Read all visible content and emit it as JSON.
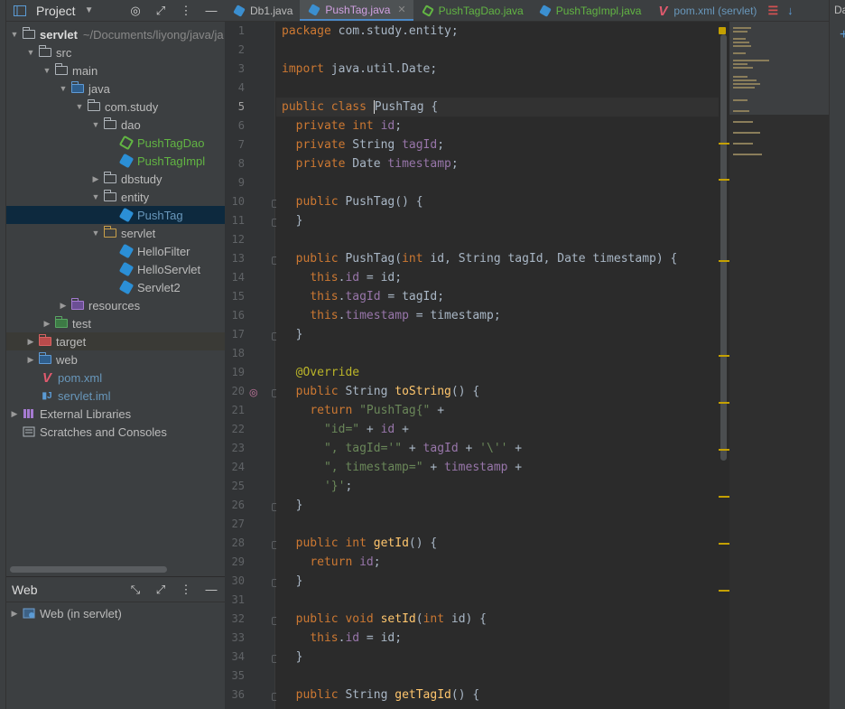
{
  "project_panel": {
    "title": "Project",
    "tree": [
      {
        "label": "servlet",
        "path": "~/Documents/liyong/java/ja"
      },
      {
        "label": "src"
      },
      {
        "label": "main"
      },
      {
        "label": "java"
      },
      {
        "label": "com.study"
      },
      {
        "label": "dao"
      },
      {
        "label": "PushTagDao"
      },
      {
        "label": "PushTagImpl"
      },
      {
        "label": "dbstudy"
      },
      {
        "label": "entity"
      },
      {
        "label": "PushTag"
      },
      {
        "label": "servlet"
      },
      {
        "label": "HelloFilter"
      },
      {
        "label": "HelloServlet"
      },
      {
        "label": "Servlet2"
      },
      {
        "label": "resources"
      },
      {
        "label": "test"
      },
      {
        "label": "target"
      },
      {
        "label": "web"
      },
      {
        "label": "pom.xml"
      },
      {
        "label": "servlet.iml"
      },
      {
        "label": "External Libraries"
      },
      {
        "label": "Scratches and Consoles"
      }
    ]
  },
  "web_panel": {
    "title": "Web",
    "items": [
      {
        "label": "Web (in servlet)"
      }
    ]
  },
  "tabs": [
    {
      "label": "Db1.java",
      "icon": "java-class-icon"
    },
    {
      "label": "PushTag.java",
      "icon": "java-class-icon",
      "active": true
    },
    {
      "label": "PushTagDao.java",
      "icon": "java-interface-icon"
    },
    {
      "label": "PushTagImpl.java",
      "icon": "java-class-icon"
    },
    {
      "label": "pom.xml (servlet)",
      "icon": "maven-icon"
    }
  ],
  "right_panel": {
    "label": "Da"
  },
  "editor": {
    "line_numbers": [
      "1",
      "2",
      "3",
      "4",
      "5",
      "6",
      "7",
      "8",
      "9",
      "10",
      "11",
      "12",
      "13",
      "14",
      "15",
      "16",
      "17",
      "18",
      "19",
      "20",
      "21",
      "22",
      "23",
      "24",
      "25",
      "26",
      "27",
      "28",
      "29",
      "30",
      "31",
      "32",
      "33",
      "34",
      "35",
      "36"
    ],
    "lines": [
      "package com.study.entity;",
      "",
      "import java.util.Date;",
      "",
      "public class PushTag {",
      "  private int id;",
      "  private String tagId;",
      "  private Date timestamp;",
      "",
      "  public PushTag() {",
      "  }",
      "",
      "  public PushTag(int id, String tagId, Date timestamp) {",
      "    this.id = id;",
      "    this.tagId = tagId;",
      "    this.timestamp = timestamp;",
      "  }",
      "",
      "  @Override",
      "  public String toString() {",
      "    return \"PushTag{\" +",
      "      \"id=\" + id +",
      "      \", tagId='\" + tagId + '\\'' +",
      "      \", timestamp=\" + timestamp +",
      "      '}';",
      "  }",
      "",
      "  public int getId() {",
      "    return id;",
      "  }",
      "",
      "  public void setId(int id) {",
      "    this.id = id;",
      "  }",
      "",
      "  public String getTagId() {"
    ]
  },
  "colors": {
    "keyword": "#cc7832",
    "string": "#6a8759",
    "field": "#9876aa",
    "method": "#ffc66d",
    "annotation": "#bbb529",
    "accent": "#4a88c7"
  }
}
